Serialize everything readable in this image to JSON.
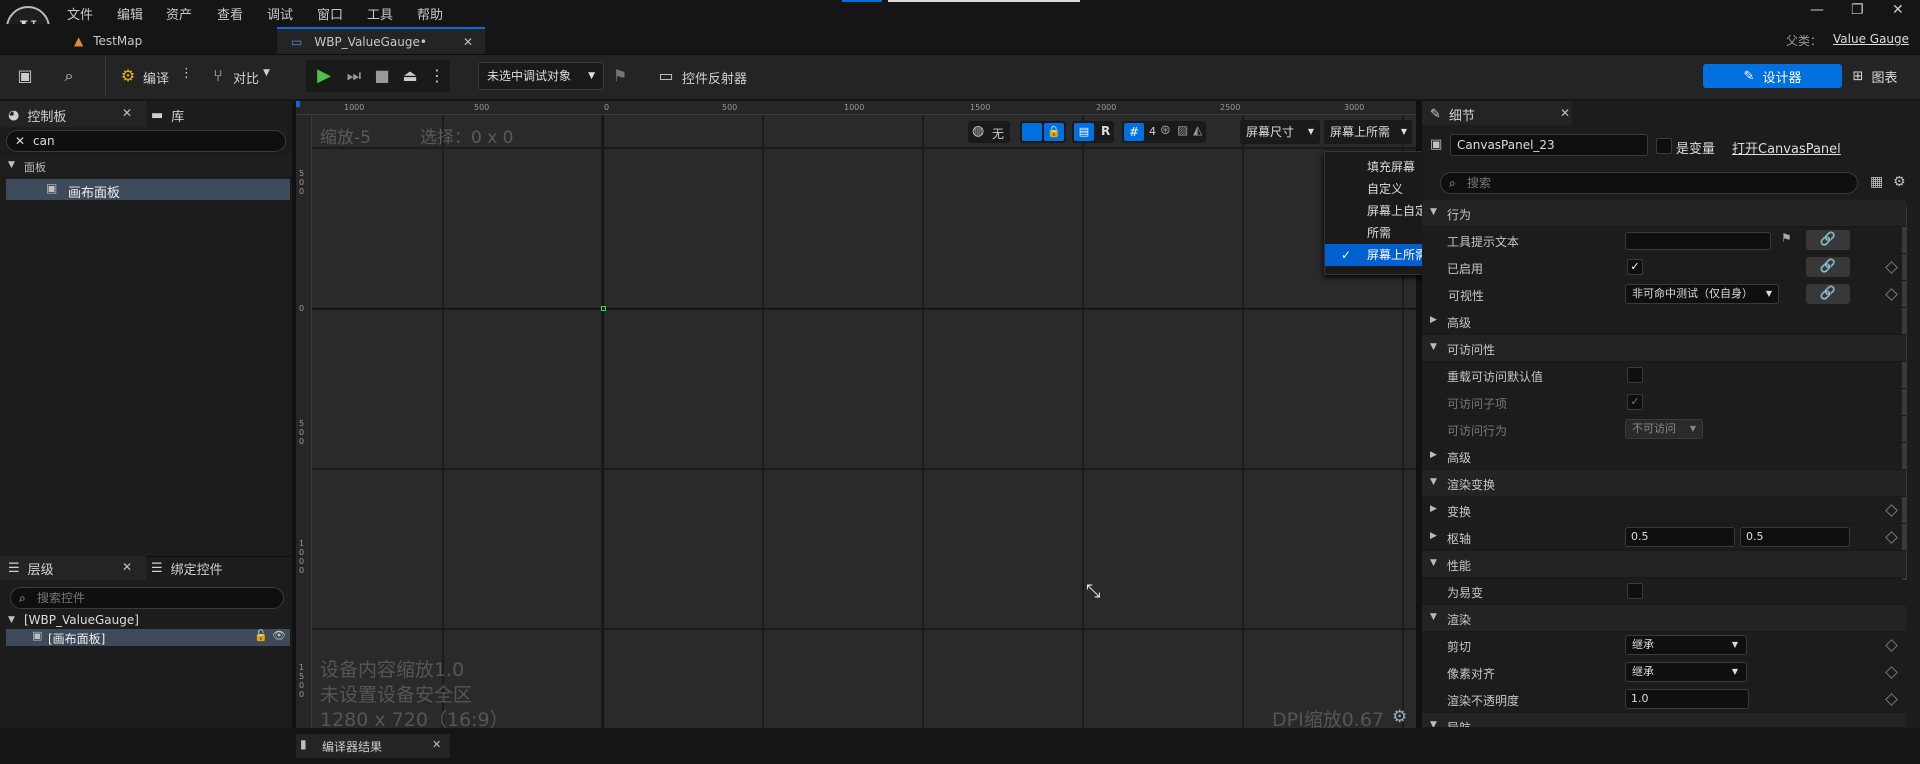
{
  "menubar": {
    "items": [
      "文件",
      "编辑",
      "资产",
      "查看",
      "调试",
      "窗口",
      "工具",
      "帮助"
    ]
  },
  "tabs": [
    {
      "label": "TestMap"
    },
    {
      "label": "WBP_ValueGauge•",
      "active": true
    }
  ],
  "parent_class": {
    "label": "父类：",
    "value": "Value Gauge"
  },
  "toolbar": {
    "compile_label": "编译",
    "diff_label": "对比",
    "debug_object": "未选中调试对象",
    "widget_reflector": "控件反射器",
    "designer_label": "设计器",
    "graph_label": "图表"
  },
  "palette": {
    "tab_label": "控制板",
    "library_label": "库",
    "search_value": "can",
    "category": "面板",
    "item": "画布面板"
  },
  "hierarchy": {
    "tab_label": "层级",
    "bind_tab_label": "绑定控件",
    "search_placeholder": "搜索控件",
    "root": "[WBP_ValueGauge]",
    "child": "[画布面板]"
  },
  "canvas": {
    "zoom": "缩放-5",
    "selection": "选择：0 x 0",
    "toolbar": {
      "none_label": "无",
      "r_label": "R",
      "grid_size": "4",
      "screen_size_label": "屏幕尺寸",
      "fill_mode_label": "屏幕上所需"
    },
    "ruler_top": [
      "1000",
      "500",
      "0",
      "500",
      "1000",
      "1500",
      "2000",
      "2500",
      "3000"
    ],
    "ruler_left": [
      "500",
      "0",
      "500",
      "1000",
      "1500"
    ],
    "device_scale": "设备内容缩放1.0",
    "safe_zone": "未设置设备安全区",
    "resolution": "1280 x 720（16:9）",
    "dpi_scale": "DPI缩放0.67"
  },
  "fill_menu": {
    "items": [
      "填充屏幕",
      "自定义",
      "屏幕上自定义",
      "所需",
      "屏幕上所需"
    ],
    "selected": "屏幕上所需"
  },
  "compiler_results": {
    "tab_label": "编译器结果"
  },
  "details": {
    "tab_label": "细节",
    "name_value": "CanvasPanel_23",
    "is_variable_label": "是变量",
    "open_link": "打开CanvasPanel",
    "search_placeholder": "搜索",
    "rows": [
      {
        "label": "行为"
      },
      {
        "label": "工具提示文本"
      },
      {
        "label": "已启用"
      },
      {
        "label": "可视性",
        "value": "非可命中测试（仅自身）"
      },
      {
        "label": "高级"
      },
      {
        "label": "可访问性"
      },
      {
        "label": "重载可访问默认值"
      },
      {
        "label": "可访问子项"
      },
      {
        "label": "可访问行为",
        "value": "不可访问"
      },
      {
        "label": "高级"
      },
      {
        "label": "渲染变换"
      },
      {
        "label": "变换"
      },
      {
        "label": "枢轴",
        "value_x": "0.5",
        "value_y": "0.5"
      },
      {
        "label": "性能"
      },
      {
        "label": "为易变"
      },
      {
        "label": "渲染"
      },
      {
        "label": "剪切",
        "value": "继承"
      },
      {
        "label": "像素对齐",
        "value": "继承"
      },
      {
        "label": "渲染不透明度",
        "value": "1.0"
      },
      {
        "label": "导航"
      }
    ]
  },
  "colors": {
    "accent": "#0070e0",
    "selection": "#0060d0",
    "panel": "#1c1c1c",
    "canvas": "#2a2a2a"
  }
}
